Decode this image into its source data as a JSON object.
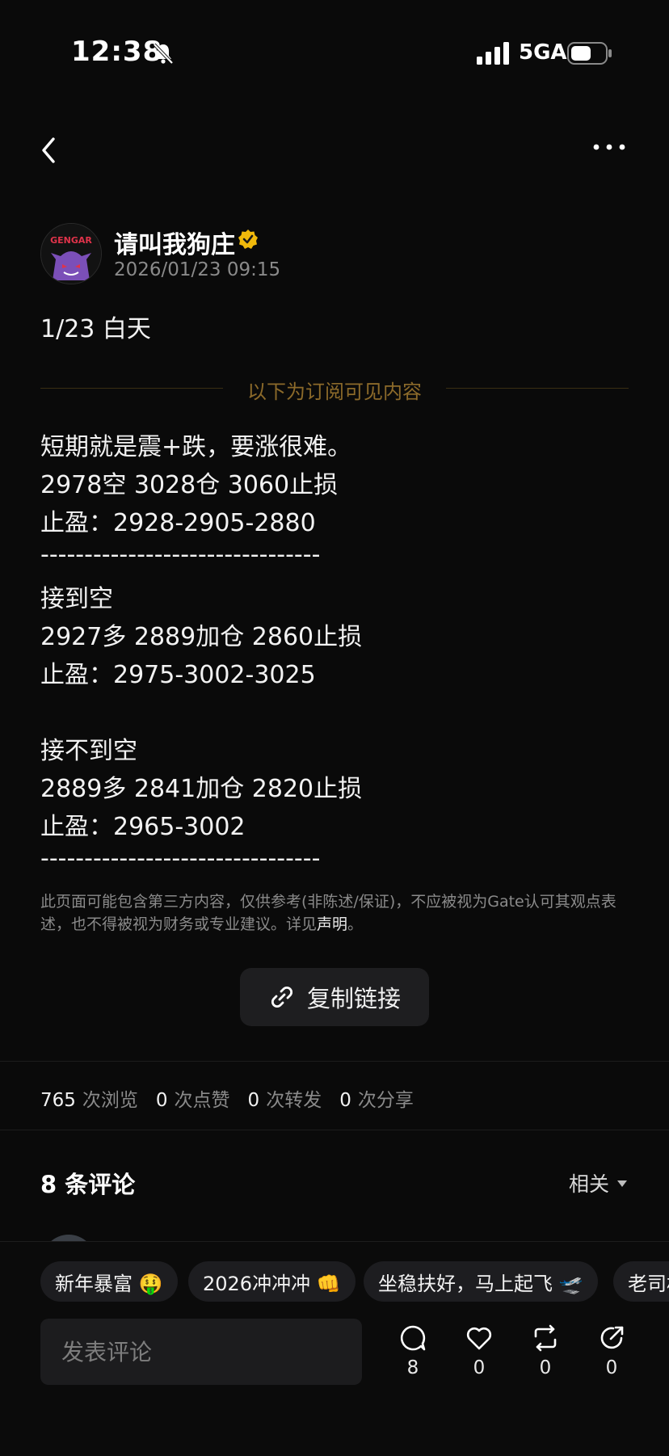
{
  "status_bar": {
    "time": "12:38",
    "network": "5GA"
  },
  "author": {
    "name": "请叫我狗庄",
    "timestamp": "2026/01/23 09:15",
    "avatar_text": "GENGAR"
  },
  "post": {
    "title": "1/23 白天",
    "subscriber_notice": "以下为订阅可见内容",
    "lines": [
      "短期就是震+跌，要涨很难。",
      "2978空 3028仓 3060止损",
      "止盈：2928-2905-2880",
      "--------------------------------",
      "接到空",
      "2927多 2889加仓 2860止损",
      "止盈：2975-3002-3025",
      "",
      "接不到空",
      "2889多 2841加仓 2820止损",
      "止盈：2965-3002",
      "--------------------------------"
    ],
    "disclaimer": "此页面可能包含第三方内容，仅供参考(非陈述/保证)，不应被视为Gate认可其观点表述，也不得被视为财务或专业建议。详见",
    "disclaimer_link": "声明",
    "disclaimer_end": "。",
    "copy_link_label": "复制链接"
  },
  "stats": {
    "views": "765",
    "views_label": "次浏览",
    "likes": "0",
    "likes_label": "次点赞",
    "reposts": "0",
    "reposts_label": "次转发",
    "shares": "0",
    "shares_label": "次分享"
  },
  "comments": {
    "title": "8 条评论",
    "sort_label": "相关"
  },
  "quick_replies": [
    "新年暴富 🤑",
    "2026冲冲冲 👊",
    "坐稳扶好，马上起飞 🛫",
    "老司机"
  ],
  "composer": {
    "placeholder": "发表评论"
  },
  "actions": {
    "comments": "8",
    "likes": "0",
    "reposts": "0",
    "shares": "0"
  },
  "colors": {
    "background": "#0a0a0a",
    "verified_badge": "#f0b90b",
    "subscriber_notice": "#8c6a2a"
  },
  "icons": [
    "bell-slash-icon",
    "signal-icon",
    "battery-icon",
    "back-icon",
    "more-icon",
    "verified-icon",
    "link-icon",
    "comment-icon",
    "heart-icon",
    "repost-icon",
    "share-icon"
  ]
}
